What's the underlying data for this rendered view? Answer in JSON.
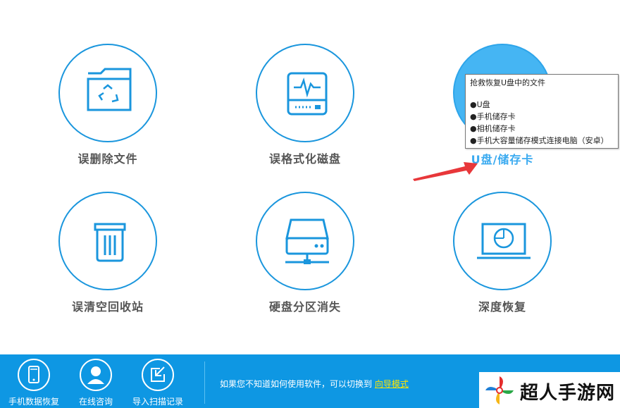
{
  "tiles": [
    {
      "label": "误删除文件",
      "icon": "folder-recycle-icon"
    },
    {
      "label": "误格式化磁盘",
      "icon": "disk-waveform-icon"
    },
    {
      "label": "U盘/储存卡",
      "icon": "usb-card-icon"
    },
    {
      "label": "误清空回收站",
      "icon": "trash-bin-icon"
    },
    {
      "label": "硬盘分区消失",
      "icon": "hard-drive-icon"
    },
    {
      "label": "深度恢复",
      "icon": "laptop-scan-icon"
    }
  ],
  "tooltip": {
    "title": "抢救恢复U盘中的文件",
    "items": [
      "●U盘",
      "●手机储存卡",
      "●相机储存卡",
      "●手机大容量储存模式连接电脑（安卓）"
    ]
  },
  "footer": {
    "buttons": [
      {
        "label": "手机数据恢复",
        "icon": "phone-icon"
      },
      {
        "label": "在线咨询",
        "icon": "user-support-icon"
      },
      {
        "label": "导入扫描记录",
        "icon": "import-icon"
      }
    ],
    "hint_text": "如果您不知道如何使用软件，可以切换到",
    "hint_link": "向导模式"
  },
  "watermark": {
    "text": "超人手游网",
    "icon": "pinwheel-logo-icon"
  },
  "colors": {
    "accent": "#1a96dd",
    "active_fill": "#45b5f3",
    "footer": "#0e97e3",
    "link": "#ffe600"
  }
}
